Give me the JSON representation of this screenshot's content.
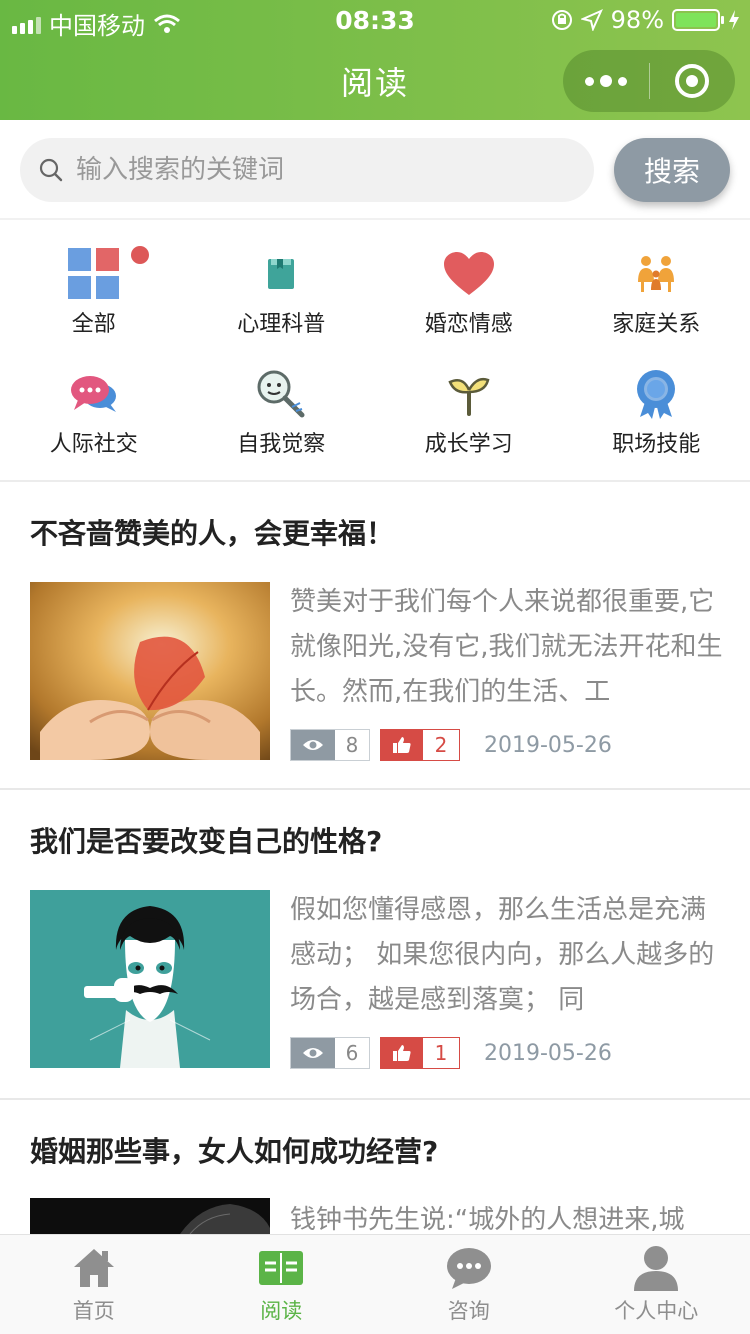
{
  "status_bar": {
    "carrier": "中国移动",
    "time": "08:33",
    "battery": "98%",
    "battery_level": 0.98
  },
  "nav": {
    "title": "阅读"
  },
  "search": {
    "placeholder": "输入搜索的关键词",
    "button_label": "搜索"
  },
  "categories": [
    {
      "label": "全部",
      "icon": "grid-icon",
      "badge": true
    },
    {
      "label": "心理科普",
      "icon": "book-icon"
    },
    {
      "label": "婚恋情感",
      "icon": "heart-icon"
    },
    {
      "label": "家庭关系",
      "icon": "family-icon"
    },
    {
      "label": "人际社交",
      "icon": "chat-bubbles-icon"
    },
    {
      "label": "自我觉察",
      "icon": "magnifier-icon"
    },
    {
      "label": "成长学习",
      "icon": "sprout-icon"
    },
    {
      "label": "职场技能",
      "icon": "award-ribbon-icon"
    }
  ],
  "articles": [
    {
      "title": "不吝啬赞美的人，会更幸福！",
      "excerpt": "赞美对于我们每个人来说都很重要,它就像阳光,没有它,我们就无法开花和生长。然而,在我们的生活、工",
      "views": "8",
      "likes": "2",
      "date": "2019-05-26",
      "image": "hands-holding-feather-photo"
    },
    {
      "title": "我们是否要改变自己的性格?",
      "excerpt": "假如您懂得感恩，那么生活总是充满感动；  如果您很内向，那么人越多的场合，越是感到落寞；  同",
      "views": "6",
      "likes": "1",
      "date": "2019-05-26",
      "image": "mustache-man-illustration"
    },
    {
      "title": "婚姻那些事，女人如何成功经营?",
      "excerpt": "钱钟书先生说:“城外的人想进来,城",
      "image": "dark-portrait-photo"
    }
  ],
  "tabbar": [
    {
      "label": "首页",
      "icon": "home-icon",
      "active": false
    },
    {
      "label": "阅读",
      "icon": "open-book-icon",
      "active": true
    },
    {
      "label": "咨询",
      "icon": "chat-icon",
      "active": false
    },
    {
      "label": "个人中心",
      "icon": "user-icon",
      "active": false
    }
  ],
  "colors": {
    "header_start": "#69b843",
    "header_end": "#8ec44f",
    "like_red": "#d64b45",
    "active_green": "#5bb447",
    "search_button": "#8e9aa4"
  }
}
